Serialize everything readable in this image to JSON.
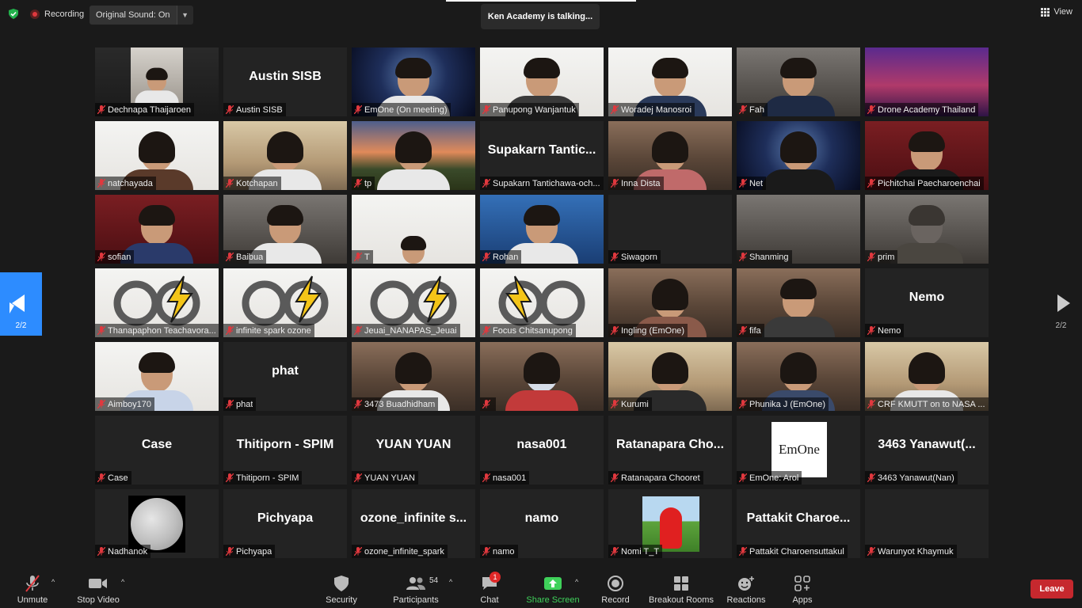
{
  "top": {
    "recording": "Recording",
    "original_sound": "Original Sound: On",
    "talking": "Ken Academy is talking...",
    "view": "View"
  },
  "pages": {
    "prev": "2/2",
    "next": "2/2"
  },
  "tiles": [
    {
      "big": "",
      "name": "Dechnapa Thaijaroen"
    },
    {
      "big": "Austin SISB",
      "name": "Austin SISB"
    },
    {
      "big": "",
      "name": "EmOne (On meeting)"
    },
    {
      "big": "",
      "name": "Panupong Wanjantuk"
    },
    {
      "big": "",
      "name": "Woradej Manosroi"
    },
    {
      "big": "",
      "name": "Fah"
    },
    {
      "big": "",
      "name": "Drone Academy Thailand"
    },
    {
      "big": "",
      "name": "natchayada"
    },
    {
      "big": "",
      "name": "Kotchapan"
    },
    {
      "big": "",
      "name": "tp"
    },
    {
      "big": "Supakarn Tantic...",
      "name": "Supakarn Tantichawa-och..."
    },
    {
      "big": "",
      "name": "Inna Dista"
    },
    {
      "big": "",
      "name": "Net"
    },
    {
      "big": "",
      "name": "Pichitchai Paecharoenchai"
    },
    {
      "big": "",
      "name": "sofian"
    },
    {
      "big": "",
      "name": "Baibua"
    },
    {
      "big": "",
      "name": "T"
    },
    {
      "big": "",
      "name": "Rohan"
    },
    {
      "big": "",
      "name": "Siwagorn"
    },
    {
      "big": "",
      "name": "Shanming"
    },
    {
      "big": "",
      "name": "prim"
    },
    {
      "big": "",
      "name": "Thanapaphon Teachavora..."
    },
    {
      "big": "",
      "name": "infinite spark ozone"
    },
    {
      "big": "",
      "name": "Jeuai_NANAPAS_Jeuai"
    },
    {
      "big": "",
      "name": "Focus Chitsanupong"
    },
    {
      "big": "",
      "name": "Ingling (EmOne)"
    },
    {
      "big": "",
      "name": "fifa"
    },
    {
      "big": "Nemo",
      "name": "Nemo"
    },
    {
      "big": "",
      "name": "Aimboy170"
    },
    {
      "big": "phat",
      "name": "phat"
    },
    {
      "big": "",
      "name": "3473 Buadhidham"
    },
    {
      "big": "",
      "name": ""
    },
    {
      "big": "",
      "name": "Kurumi"
    },
    {
      "big": "",
      "name": "Phunika J (EmOne)"
    },
    {
      "big": "",
      "name": "CRF KMUTT on to NASA ..."
    },
    {
      "big": "Case",
      "name": "Case"
    },
    {
      "big": "Thitiporn - SPIM",
      "name": "Thitiporn - SPIM"
    },
    {
      "big": "YUAN YUAN",
      "name": "YUAN YUAN"
    },
    {
      "big": "nasa001",
      "name": "nasa001"
    },
    {
      "big": "Ratanapara Cho...",
      "name": "Ratanapara Chooret"
    },
    {
      "big": "",
      "name": "EmOne: Arol",
      "logo": "EmOne"
    },
    {
      "big": "3463 Yanawut(...",
      "name": "3463 Yanawut(Nan)"
    },
    {
      "big": "",
      "name": "Nadhanok"
    },
    {
      "big": "Pichyapa",
      "name": "Pichyapa"
    },
    {
      "big": "ozone_infinite s...",
      "name": "ozone_infinite_spark"
    },
    {
      "big": "namo",
      "name": "namo"
    },
    {
      "big": "",
      "name": "Nomi T_T"
    },
    {
      "big": "Pattakit Charoe...",
      "name": "Pattakit Charoensuttakul"
    },
    {
      "big": "",
      "name": "Warunyot Khaymuk"
    }
  ],
  "toolbar": {
    "unmute": "Unmute",
    "stop_video": "Stop Video",
    "security": "Security",
    "participants": "Participants",
    "participant_count": "54",
    "chat": "Chat",
    "chat_badge": "1",
    "share_screen": "Share Screen",
    "record": "Record",
    "breakout_rooms": "Breakout Rooms",
    "reactions": "Reactions",
    "apps": "Apps",
    "leave": "Leave"
  },
  "colors": {
    "accent": "#2d8cff",
    "leave": "#c6282e",
    "share": "#3fd15a",
    "mute": "#e0383e"
  }
}
